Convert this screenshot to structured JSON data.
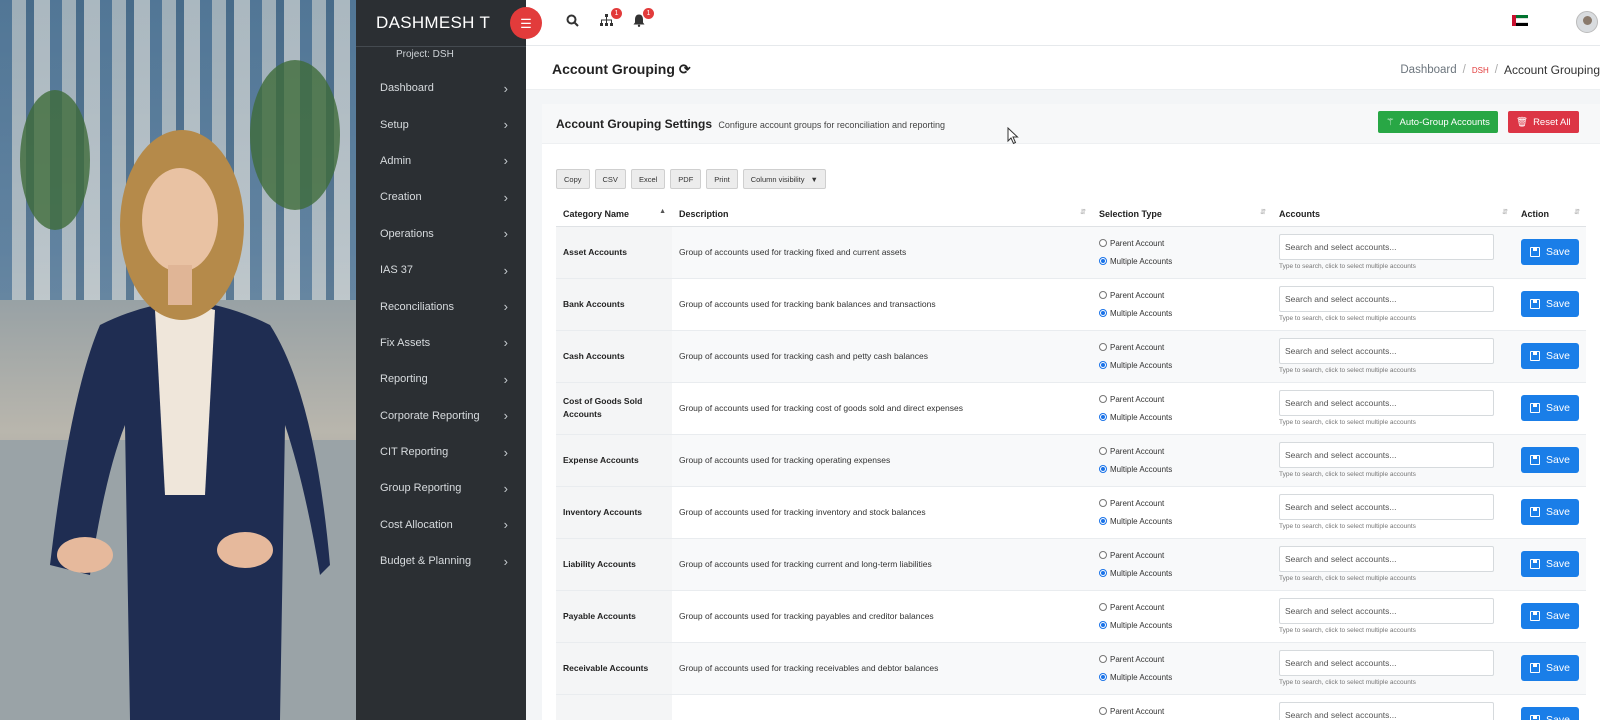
{
  "app": {
    "brand": "DASHMESH T",
    "project": "Project: DSH"
  },
  "topbar": {
    "menu_icon": "menu-icon",
    "network_badge": "1",
    "bell_badge": "1"
  },
  "sidebar": {
    "items": [
      {
        "label": "Dashboard"
      },
      {
        "label": "Setup"
      },
      {
        "label": "Admin"
      },
      {
        "label": "Creation"
      },
      {
        "label": "Operations"
      },
      {
        "label": "IAS 37"
      },
      {
        "label": "Reconciliations"
      },
      {
        "label": "Fix Assets"
      },
      {
        "label": "Reporting"
      },
      {
        "label": "Corporate Reporting"
      },
      {
        "label": "CIT Reporting"
      },
      {
        "label": "Group Reporting"
      },
      {
        "label": "Cost Allocation"
      },
      {
        "label": "Budget & Planning"
      }
    ]
  },
  "page": {
    "title": "Account Grouping",
    "breadcrumb": {
      "home": "Dashboard",
      "project": "DSH",
      "current": "Account Grouping"
    }
  },
  "card": {
    "title": "Account Grouping Settings",
    "subtitle": "Configure account groups for reconciliation and reporting",
    "auto_group_label": "Auto-Group Accounts",
    "reset_label": "Reset All"
  },
  "table_buttons": [
    "Copy",
    "CSV",
    "Excel",
    "PDF",
    "Print",
    "Column visibility"
  ],
  "table": {
    "headers": [
      "Category Name",
      "Description",
      "Selection Type",
      "Accounts",
      "Action"
    ],
    "radio_parent": "Parent Account",
    "radio_multiple": "Multiple Accounts",
    "search_placeholder": "Search and select accounts...",
    "hint": "Type to search, click to select multiple accounts",
    "save_label": "Save",
    "rows": [
      {
        "category": "Asset Accounts",
        "description": "Group of accounts used for tracking fixed and current assets"
      },
      {
        "category": "Bank Accounts",
        "description": "Group of accounts used for tracking bank balances and transactions"
      },
      {
        "category": "Cash Accounts",
        "description": "Group of accounts used for tracking cash and petty cash balances"
      },
      {
        "category": "Cost of Goods Sold Accounts",
        "description": "Group of accounts used for tracking cost of goods sold and direct expenses"
      },
      {
        "category": "Expense Accounts",
        "description": "Group of accounts used for tracking operating expenses"
      },
      {
        "category": "Inventory Accounts",
        "description": "Group of accounts used for tracking inventory and stock balances"
      },
      {
        "category": "Liability Accounts",
        "description": "Group of accounts used for tracking current and long-term liabilities"
      },
      {
        "category": "Payable Accounts",
        "description": "Group of accounts used for tracking payables and creditor balances"
      },
      {
        "category": "Receivable Accounts",
        "description": "Group of accounts used for tracking receivables and debtor balances"
      },
      {
        "category": "",
        "description": ""
      }
    ]
  },
  "colors": {
    "accent_red": "#e23b3b",
    "save_blue": "#1a7ee8",
    "green": "#28a745",
    "sidebar_bg": "#2b2f33"
  }
}
